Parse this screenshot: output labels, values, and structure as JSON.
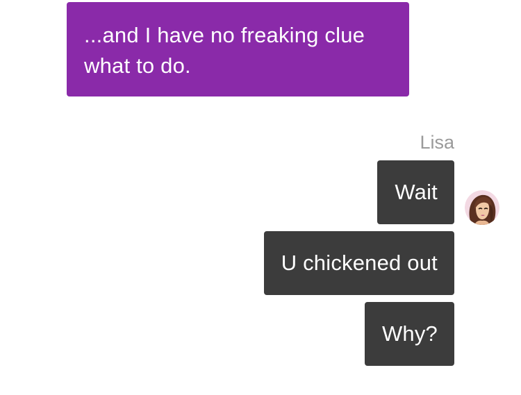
{
  "conversation": {
    "sent_message": "...and I have no freaking clue what to do.",
    "received": {
      "sender": "Lisa",
      "avatar_icon": "profile-photo-woman",
      "messages": [
        "Wait",
        "U chickened out",
        "Why?"
      ]
    }
  },
  "colors": {
    "sent_bubble": "#8a2aa9",
    "received_bubble": "#3c3c3c",
    "sender_name": "#9a9a9a",
    "text": "#ffffff"
  }
}
